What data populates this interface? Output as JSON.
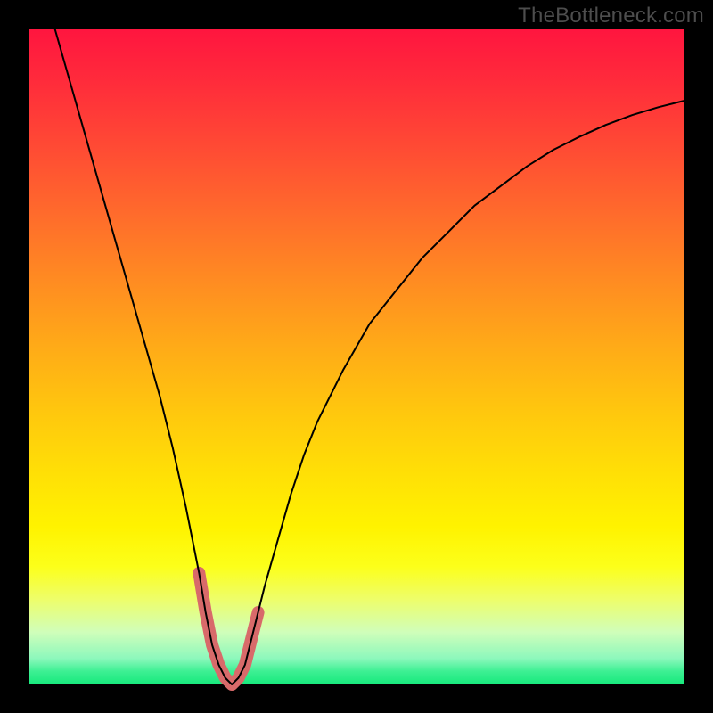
{
  "watermark": "TheBottleneck.com",
  "chart_data": {
    "type": "line",
    "title": "",
    "xlabel": "",
    "ylabel": "",
    "xlim": [
      0,
      100
    ],
    "ylim": [
      0,
      100
    ],
    "series": [
      {
        "name": "main-curve",
        "stroke": "#000000",
        "stroke_width": 2,
        "x": [
          4,
          6,
          8,
          10,
          12,
          14,
          16,
          18,
          20,
          22,
          24,
          25,
          26,
          27,
          28,
          29,
          30,
          31,
          32,
          33,
          34,
          36,
          38,
          40,
          42,
          44,
          48,
          52,
          56,
          60,
          64,
          68,
          72,
          76,
          80,
          84,
          88,
          92,
          96,
          100
        ],
        "y": [
          100,
          93,
          86,
          79,
          72,
          65,
          58,
          51,
          44,
          36,
          27,
          22,
          17,
          11,
          6,
          3,
          1,
          0,
          1,
          3,
          7,
          15,
          22,
          29,
          35,
          40,
          48,
          55,
          60,
          65,
          69,
          73,
          76,
          79,
          81.5,
          83.5,
          85.3,
          86.8,
          88,
          89
        ]
      },
      {
        "name": "highlight-segment",
        "stroke": "#d86a6a",
        "stroke_width": 14,
        "x": [
          26,
          27,
          28,
          29,
          30,
          31,
          32,
          33,
          34,
          35
        ],
        "y": [
          17,
          11,
          6,
          3,
          1,
          0,
          1,
          3,
          7,
          11
        ]
      }
    ]
  }
}
